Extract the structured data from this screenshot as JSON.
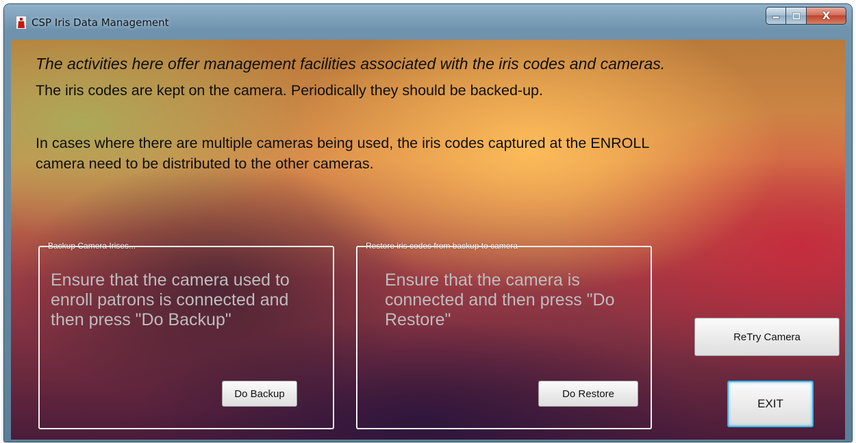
{
  "window": {
    "title": "CSP Iris Data Management",
    "title_icon": "app-bottle-icon",
    "caption": {
      "minimize_icon": "minimize-icon",
      "maximize_icon": "maximize-icon",
      "close_label": "X"
    }
  },
  "main": {
    "headline": "The activities here offer management facilities associated with the iris codes and cameras.",
    "paragraph1": "The iris codes are kept on the camera.  Periodically they should be backed-up.",
    "paragraph2": "In cases where there are multiple cameras being used, the iris codes captured at the ENROLL camera need to be distributed to the other cameras."
  },
  "backup": {
    "legend": "Backup Camera Irises...",
    "text": "Ensure that the camera used to enroll patrons is connected and then press \"Do Backup\"",
    "button": "Do Backup"
  },
  "restore": {
    "legend": "Restore iris codes from backup to camera",
    "text": "Ensure that the camera is connected and then press \"Do Restore\"",
    "button": "Do Restore"
  },
  "actions": {
    "retry": "ReTry Camera",
    "exit": "EXIT"
  },
  "colors": {
    "frame": "#6f93ad",
    "close": "#c0432a",
    "exit_focus": "#3bb4e8",
    "groupbox_text": "#bdbdbd"
  }
}
